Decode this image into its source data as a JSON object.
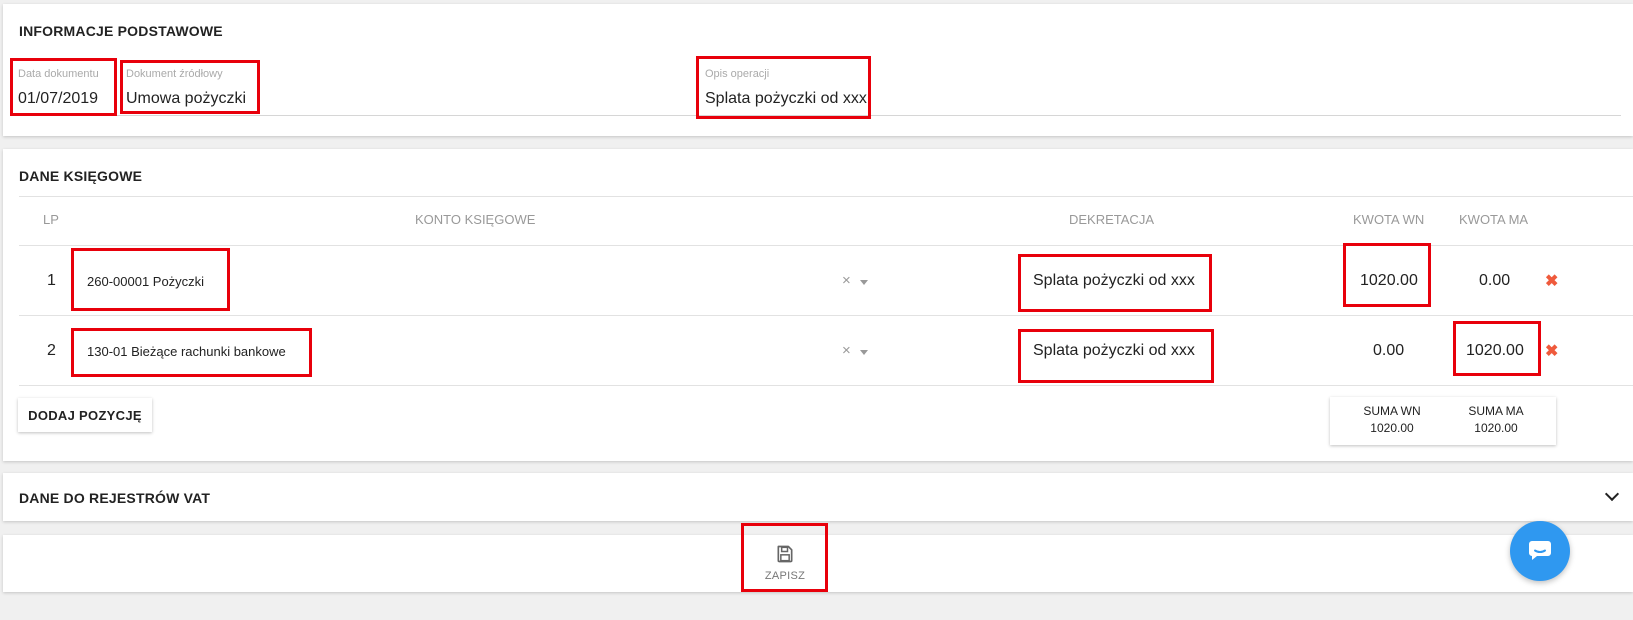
{
  "basic_info": {
    "title": "INFORMACJE PODSTAWOWE",
    "document_date": {
      "label": "Data dokumentu",
      "value": "01/07/2019"
    },
    "source_document": {
      "label": "Dokument źródłowy",
      "value": "Umowa pożyczki"
    },
    "operation_description": {
      "label": "Opis operacji",
      "value": "Splata pożyczki od xxx"
    }
  },
  "ledger": {
    "title": "DANE KSIĘGOWE",
    "columns": {
      "lp": "LP",
      "account": "KONTO KSIĘGOWE",
      "decree": "DEKRETACJA",
      "debit": "KWOTA WN",
      "credit": "KWOTA MA"
    },
    "rows": [
      {
        "lp": "1",
        "account": "260-00001 Pożyczki",
        "decree": "Splata pożyczki od xxx",
        "debit": "1020.00",
        "credit": "0.00"
      },
      {
        "lp": "2",
        "account": "130-01 Bieżące rachunki bankowe",
        "decree": "Splata pożyczki od xxx",
        "debit": "0.00",
        "credit": "1020.00"
      }
    ],
    "add_button": "DODAJ POZYCJĘ",
    "sum": {
      "debit_label": "SUMA WN",
      "debit_value": "1020.00",
      "credit_label": "SUMA MA",
      "credit_value": "1020.00"
    },
    "clear_glyph": "×",
    "delete_glyph": "✖"
  },
  "vat": {
    "title": "DANE DO REJESTRÓW VAT"
  },
  "footer": {
    "save_label": "ZAPISZ"
  },
  "icons": {
    "save": "save-icon",
    "chat": "chat-icon",
    "expand": "chevron-down-icon",
    "delete": "delete-icon",
    "clear": "clear-icon",
    "dropdown": "caret-down-icon"
  },
  "colors": {
    "highlight": "#e8000b",
    "delete": "#ef5a3c",
    "chat": "#2f98f0"
  }
}
